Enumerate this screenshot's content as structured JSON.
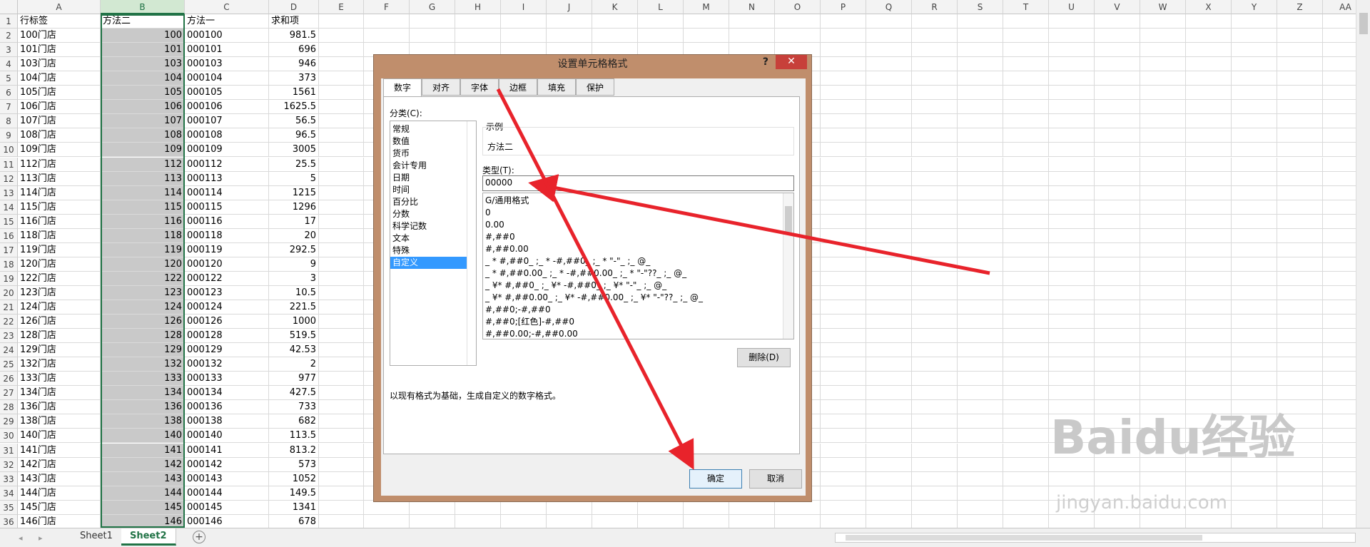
{
  "columns": [
    "A",
    "B",
    "C",
    "D",
    "E",
    "F",
    "G",
    "H",
    "I",
    "J",
    "K",
    "L",
    "M",
    "N",
    "O",
    "P",
    "Q",
    "R",
    "S",
    "T",
    "U",
    "V",
    "W",
    "X",
    "Y",
    "Z",
    "AA"
  ],
  "rows": [
    [
      "1",
      "行标签",
      "方法二",
      "方法一",
      "求和项"
    ],
    [
      "2",
      "100门店",
      "100",
      "000100",
      "981.5"
    ],
    [
      "3",
      "101门店",
      "101",
      "000101",
      "696"
    ],
    [
      "4",
      "103门店",
      "103",
      "000103",
      "946"
    ],
    [
      "5",
      "104门店",
      "104",
      "000104",
      "373"
    ],
    [
      "6",
      "105门店",
      "105",
      "000105",
      "1561"
    ],
    [
      "7",
      "106门店",
      "106",
      "000106",
      "1625.5"
    ],
    [
      "8",
      "107门店",
      "107",
      "000107",
      "56.5"
    ],
    [
      "9",
      "108门店",
      "108",
      "000108",
      "96.5"
    ],
    [
      "10",
      "109门店",
      "109",
      "000109",
      "3005"
    ],
    [
      "11",
      "112门店",
      "112",
      "000112",
      "25.5"
    ],
    [
      "12",
      "113门店",
      "113",
      "000113",
      "5"
    ],
    [
      "13",
      "114门店",
      "114",
      "000114",
      "1215"
    ],
    [
      "14",
      "115门店",
      "115",
      "000115",
      "1296"
    ],
    [
      "15",
      "116门店",
      "116",
      "000116",
      "17"
    ],
    [
      "16",
      "118门店",
      "118",
      "000118",
      "20"
    ],
    [
      "17",
      "119门店",
      "119",
      "000119",
      "292.5"
    ],
    [
      "18",
      "120门店",
      "120",
      "000120",
      "9"
    ],
    [
      "19",
      "122门店",
      "122",
      "000122",
      "3"
    ],
    [
      "20",
      "123门店",
      "123",
      "000123",
      "10.5"
    ],
    [
      "21",
      "124门店",
      "124",
      "000124",
      "221.5"
    ],
    [
      "22",
      "126门店",
      "126",
      "000126",
      "1000"
    ],
    [
      "23",
      "128门店",
      "128",
      "000128",
      "519.5"
    ],
    [
      "24",
      "129门店",
      "129",
      "000129",
      "42.53"
    ],
    [
      "25",
      "132门店",
      "132",
      "000132",
      "2"
    ],
    [
      "26",
      "133门店",
      "133",
      "000133",
      "977"
    ],
    [
      "27",
      "134门店",
      "134",
      "000134",
      "427.5"
    ],
    [
      "28",
      "136门店",
      "136",
      "000136",
      "733"
    ],
    [
      "29",
      "138门店",
      "138",
      "000138",
      "682"
    ],
    [
      "30",
      "140门店",
      "140",
      "000140",
      "113.5"
    ],
    [
      "31",
      "141门店",
      "141",
      "000141",
      "813.2"
    ],
    [
      "32",
      "142门店",
      "142",
      "000142",
      "573"
    ],
    [
      "33",
      "143门店",
      "143",
      "000143",
      "1052"
    ],
    [
      "34",
      "144门店",
      "144",
      "000144",
      "149.5"
    ],
    [
      "35",
      "145门店",
      "145",
      "000145",
      "1341"
    ],
    [
      "36",
      "146门店",
      "146",
      "000146",
      "678"
    ]
  ],
  "sheets": [
    "Sheet1",
    "Sheet2"
  ],
  "active_sheet": "Sheet2",
  "dialog": {
    "title": "设置单元格格式",
    "help": "?",
    "close": "✕",
    "tabs": [
      "数字",
      "对齐",
      "字体",
      "边框",
      "填充",
      "保护"
    ],
    "category_label": "分类(C):",
    "categories": [
      "常规",
      "数值",
      "货币",
      "会计专用",
      "日期",
      "时间",
      "百分比",
      "分数",
      "科学记数",
      "文本",
      "特殊",
      "自定义"
    ],
    "selected_category": "自定义",
    "sample_label": "示例",
    "sample_value": "方法二",
    "type_label": "类型(T):",
    "type_value": "00000",
    "formats": [
      "G/通用格式",
      "0",
      "0.00",
      "#,##0",
      "#,##0.00",
      "_ * #,##0_ ;_ * -#,##0_ ;_ * \"-\"_ ;_ @_",
      "_ * #,##0.00_ ;_ * -#,##0.00_ ;_ * \"-\"??_ ;_ @_",
      "_ ¥* #,##0_ ;_ ¥* -#,##0_ ;_ ¥* \"-\"_ ;_ @_",
      "_ ¥* #,##0.00_ ;_ ¥* -#,##0.00_ ;_ ¥* \"-\"??_ ;_ @_",
      "#,##0;-#,##0",
      "#,##0;[红色]-#,##0",
      "#,##0.00;-#,##0.00"
    ],
    "delete_label": "删除(D)",
    "description": "以现有格式为基础，生成自定义的数字格式。",
    "ok_label": "确定",
    "cancel_label": "取消"
  },
  "watermark": {
    "brand": "Baidu经验",
    "url": "jingyan.baidu.com"
  },
  "colors": {
    "accent": "#217346",
    "arrow": "#e8232b",
    "dialog_frame": "#c08e6c"
  }
}
